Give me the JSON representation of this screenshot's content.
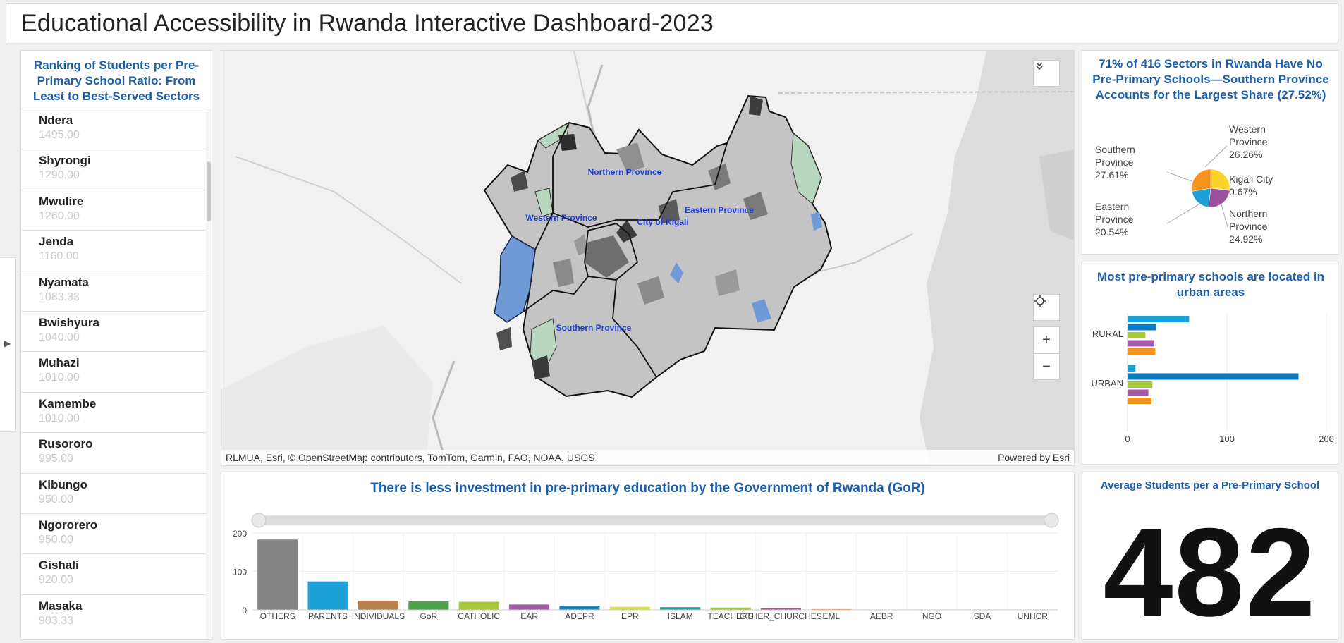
{
  "header": {
    "title": "Educational Accessibility in Rwanda Interactive Dashboard-2023"
  },
  "ranking": {
    "title": "Ranking of Students per Pre-Primary School Ratio: From Least to Best-Served Sectors",
    "items": [
      {
        "name": "Ndera",
        "value": "1495.00"
      },
      {
        "name": "Shyrongi",
        "value": "1290.00"
      },
      {
        "name": "Mwulire",
        "value": "1260.00"
      },
      {
        "name": "Jenda",
        "value": "1160.00"
      },
      {
        "name": "Nyamata",
        "value": "1083.33"
      },
      {
        "name": "Bwishyura",
        "value": "1040.00"
      },
      {
        "name": "Muhazi",
        "value": "1010.00"
      },
      {
        "name": "Kamembe",
        "value": "1010.00"
      },
      {
        "name": "Rusororo",
        "value": "995.00"
      },
      {
        "name": "Kibungo",
        "value": "950.00"
      },
      {
        "name": "Ngororero",
        "value": "950.00"
      },
      {
        "name": "Gishali",
        "value": "920.00"
      },
      {
        "name": "Masaka",
        "value": "903.33"
      }
    ]
  },
  "map": {
    "labels": {
      "northern": "Northern Province",
      "western": "Western Province",
      "kigali": "City of Kigali",
      "eastern": "Eastern Province",
      "southern": "Southern Province"
    },
    "attribution": "RLMUA, Esri, © OpenStreetMap contributors, TomTom, Garmin, FAO, NOAA, USGS",
    "powered_by": "Powered by Esri",
    "zoom_in": "+",
    "zoom_out": "−",
    "colors": {
      "water": "#6f9ad6",
      "park": "#b9d6bf",
      "sector": "#c4c4c4"
    }
  },
  "chart_data": [
    {
      "type": "pie",
      "title": "71% of 416 Sectors in Rwanda Have No Pre-Primary Schools—Southern Province Accounts for the Largest Share (27.52%)",
      "slices": [
        {
          "label": "Western Province",
          "value": 26.26,
          "pct": "26.26%",
          "color": "#fcd22b"
        },
        {
          "label": "Kigali City",
          "value": 0.67,
          "pct": "0.67%",
          "color": "#2f8f3f"
        },
        {
          "label": "Northern Province",
          "value": 24.92,
          "pct": "24.92%",
          "color": "#9b4f9f"
        },
        {
          "label": "Eastern Province",
          "value": 20.54,
          "pct": "20.54%",
          "color": "#1ba1d6"
        },
        {
          "label": "Southern Province",
          "value": 27.61,
          "pct": "27.61%",
          "color": "#f7941d"
        }
      ]
    },
    {
      "type": "bar",
      "orientation": "horizontal",
      "title": "Most pre-primary schools are located in urban areas",
      "categories": [
        "RURAL",
        "URBAN"
      ],
      "series": [
        {
          "values": [
            62,
            8
          ],
          "color": "#1ba1d6"
        },
        {
          "values": [
            29,
            172
          ],
          "color": "#0b79c2"
        },
        {
          "values": [
            18,
            25
          ],
          "color": "#a6c93a"
        },
        {
          "values": [
            27,
            21
          ],
          "color": "#a35ba8"
        },
        {
          "values": [
            28,
            24
          ],
          "color": "#f7941d"
        }
      ],
      "xticks": [
        "0",
        "100",
        "200"
      ],
      "xlim": [
        0,
        200
      ],
      "grid": true
    },
    {
      "type": "bar",
      "title": "There is less investment in pre-primary education by the Government of Rwanda (GoR)",
      "categories": [
        "OTHERS",
        "PARENTS",
        "INDIVIDUALS",
        "GoR",
        "CATHOLIC",
        "EAR",
        "ADEPR",
        "EPR",
        "ISLAM",
        "TEACHERS",
        "OTHER_CHURCHES",
        "EML",
        "AEBR",
        "NGO",
        "SDA",
        "UNHCR"
      ],
      "values": [
        183,
        74,
        24,
        22,
        21,
        14,
        11,
        8,
        7,
        6,
        4,
        2,
        1,
        1,
        1,
        1
      ],
      "colors": [
        "#858585",
        "#1ba1d6",
        "#b9804b",
        "#4aa54a",
        "#a6c93a",
        "#a35ba8",
        "#1a85c5",
        "#d4df37",
        "#23a39b",
        "#9bc43a",
        "#c24d9b",
        "#f7941d",
        "#1ba1d6",
        "#a35ba8",
        "#1ba1d6",
        "#c24d9b"
      ],
      "yticks": [
        "200",
        "100",
        "0"
      ],
      "ylim": [
        0,
        200
      ],
      "grid": true
    }
  ],
  "avg": {
    "title": "Average Students per a Pre-Primary School",
    "value": "482"
  }
}
